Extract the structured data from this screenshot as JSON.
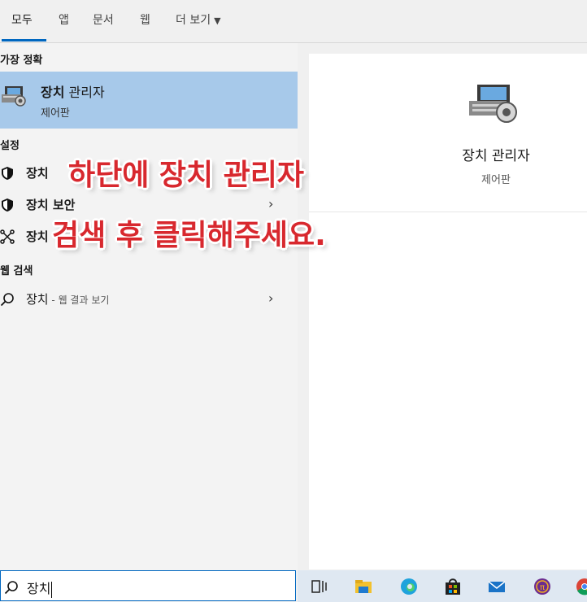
{
  "tabs": [
    {
      "label": "모두"
    },
    {
      "label": "앱"
    },
    {
      "label": "문서"
    },
    {
      "label": "웹"
    },
    {
      "label": "더 보기"
    }
  ],
  "sections": {
    "best_match": "가장 정확",
    "settings": "설정",
    "web_search": "웹 검색"
  },
  "best_match": {
    "title_bold": "장치",
    "title_rest": " 관리자",
    "subtitle": "제어판",
    "icon": "device-manager-icon"
  },
  "settings_items": [
    {
      "label": "장치 ",
      "icon": "shield-icon"
    },
    {
      "label": "장치 보안",
      "icon": "shield-icon"
    },
    {
      "label": "장치",
      "icon": "network-icon"
    }
  ],
  "web_item": {
    "label": "장치",
    "suffix": " - 웹 결과 보기",
    "icon": "search-icon"
  },
  "detail": {
    "title": "장치 관리자",
    "subtitle": "제어판",
    "icon": "device-manager-icon"
  },
  "search": {
    "value": "장치",
    "icon": "search-icon"
  },
  "taskbar_icons": [
    "task-view-icon",
    "file-explorer-icon",
    "edge-icon",
    "store-icon",
    "mail-icon",
    "pi-app-icon",
    "chrome-icon"
  ],
  "overlay": {
    "line1": "하단에 장치 관리자",
    "line2": "검색 후 클릭해주세요."
  },
  "colors": {
    "accent": "#0067c0",
    "highlight": "#a7c9ea",
    "overlay_text": "#d8282e"
  }
}
